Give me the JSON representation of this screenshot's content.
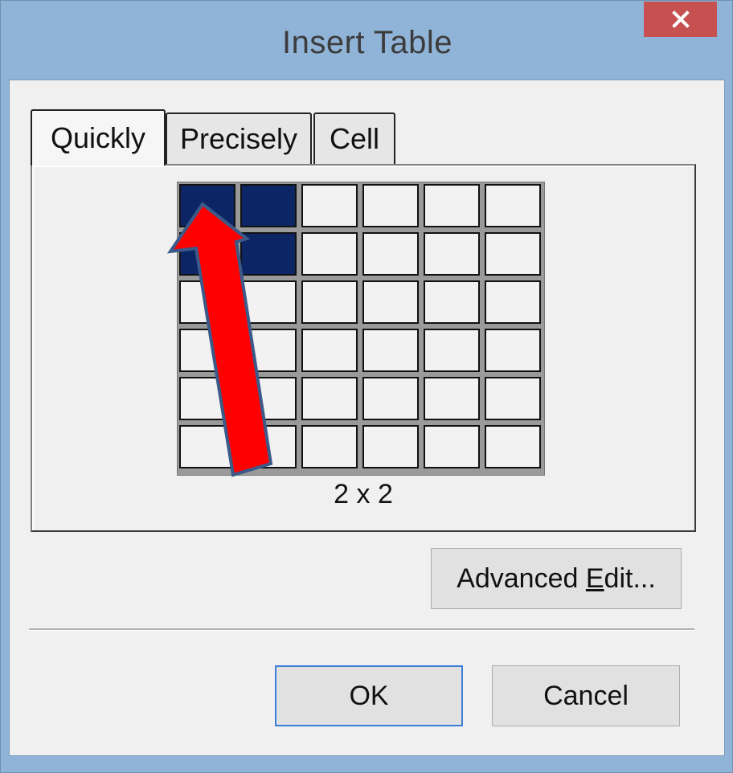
{
  "window": {
    "title": "Insert Table",
    "close_icon": "close-icon"
  },
  "tabs": [
    {
      "label": "Quickly",
      "active": true
    },
    {
      "label": "Precisely",
      "active": false
    },
    {
      "label": "Cell",
      "active": false
    }
  ],
  "grid": {
    "rows": 6,
    "cols": 6,
    "selected_rows": 2,
    "selected_cols": 2,
    "selection_color": "#0b2565",
    "size_label": "2 x 2"
  },
  "annotation": {
    "arrow_color": "#ff0000",
    "arrow_outline_color": "#3b5a8a"
  },
  "buttons": {
    "advanced_edit_prefix": "Advanced ",
    "advanced_edit_underlined": "E",
    "advanced_edit_suffix": "dit...",
    "ok": "OK",
    "cancel": "Cancel"
  }
}
